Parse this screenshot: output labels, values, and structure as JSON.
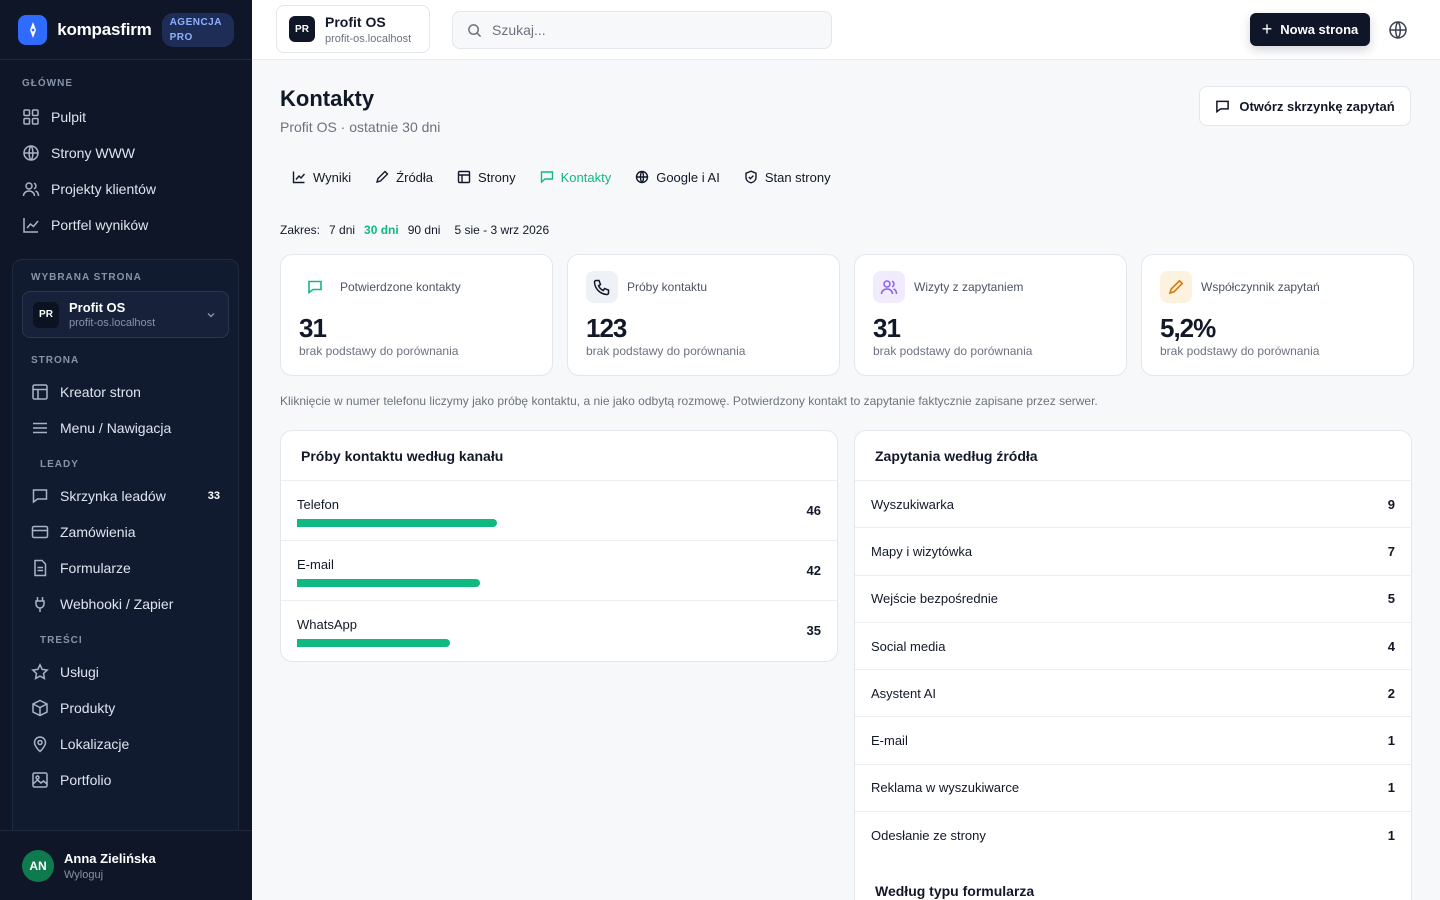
{
  "brand": {
    "name": "kompasfirm",
    "badge": "AGENCJA PRO"
  },
  "sidebar": {
    "main_label": "GŁÓWNE",
    "main_items": [
      {
        "label": "Pulpit",
        "icon": "grid-icon"
      },
      {
        "label": "Strony WWW",
        "icon": "globe-icon"
      },
      {
        "label": "Projekty klientów",
        "icon": "users-icon"
      },
      {
        "label": "Portfel wyników",
        "icon": "chart-icon"
      }
    ],
    "selected_site_label": "WYBRANA STRONA",
    "selected_site": {
      "initials": "PR",
      "name": "Profit OS",
      "domain": "profit-os.localhost"
    },
    "page_label": "STRONA",
    "page_items": [
      {
        "label": "Kreator stron",
        "icon": "layout-icon"
      },
      {
        "label": "Menu / Nawigacja",
        "icon": "menu-icon"
      }
    ],
    "leads_label": "LEADY",
    "leads_items": [
      {
        "label": "Skrzynka leadów",
        "icon": "inbox-icon",
        "count": "33"
      },
      {
        "label": "Zamówienia",
        "icon": "card-icon"
      },
      {
        "label": "Formularze",
        "icon": "file-icon"
      },
      {
        "label": "Webhooki / Zapier",
        "icon": "plug-icon"
      }
    ],
    "content_label": "TREŚCI",
    "content_items": [
      {
        "label": "Usługi",
        "icon": "star-icon"
      },
      {
        "label": "Produkty",
        "icon": "box-icon"
      },
      {
        "label": "Lokalizacje",
        "icon": "pin-icon"
      },
      {
        "label": "Portfolio",
        "icon": "image-icon"
      }
    ],
    "user": {
      "initials": "AN",
      "name": "Anna Zielińska",
      "logout": "Wyloguj"
    }
  },
  "topbar": {
    "site": {
      "initials": "PR",
      "name": "Profit OS",
      "domain": "profit-os.localhost"
    },
    "search_placeholder": "Szukaj...",
    "new_button": "Nowa strona"
  },
  "page": {
    "title": "Kontakty",
    "subtitle": "Profit OS · ostatnie 30 dni",
    "inbox_button": "Otwórz skrzynkę zapytań",
    "tabs": [
      {
        "label": "Wyniki",
        "icon": "chart-icon"
      },
      {
        "label": "Źródła",
        "icon": "pen-icon"
      },
      {
        "label": "Strony",
        "icon": "layout-icon"
      },
      {
        "label": "Kontakty",
        "icon": "message-icon",
        "active": true
      },
      {
        "label": "Google i AI",
        "icon": "globe-icon"
      },
      {
        "label": "Stan strony",
        "icon": "shield-icon"
      }
    ],
    "range": {
      "label": "Zakres:",
      "options": [
        "7 dni",
        "30 dni",
        "90 dni"
      ],
      "active": "30 dni",
      "dates": "5 sie - 3 wrz 2026"
    },
    "kpis": [
      {
        "label": "Potwierdzone kontakty",
        "value": "31",
        "compare": "brak podstawy do porównania",
        "icon": "message-icon",
        "color": "#10b981",
        "bg": "#ffffff"
      },
      {
        "label": "Próby kontaktu",
        "value": "123",
        "compare": "brak podstawy do porównania",
        "icon": "phone-icon",
        "color": "#111827",
        "bg": "#eef1f6"
      },
      {
        "label": "Wizyty z zapytaniem",
        "value": "31",
        "compare": "brak podstawy do porównania",
        "icon": "users-icon",
        "color": "#8b5cf6",
        "bg": "#f1ecfd"
      },
      {
        "label": "Współczynnik zapytań",
        "value": "5,2%",
        "compare": "brak podstawy do porównania",
        "icon": "pen-icon",
        "color": "#f59e0b",
        "bg": "#fdf1e0"
      }
    ],
    "note": "Kliknięcie w numer telefonu liczymy jako próbę kontaktu, a nie jako odbytą rozmowę. Potwierdzony kontakt to zapytanie faktycznie zapisane przez serwer.",
    "channels": {
      "title": "Próby kontaktu według kanału",
      "rows": [
        {
          "name": "Telefon",
          "value": "46",
          "share": 0.4
        },
        {
          "name": "E-mail",
          "value": "42",
          "share": 0.365
        },
        {
          "name": "WhatsApp",
          "value": "35",
          "share": 0.305
        }
      ]
    },
    "sources": {
      "title": "Zapytania według źródła",
      "rows": [
        {
          "name": "Wyszukiwarka",
          "value": "9"
        },
        {
          "name": "Mapy i wizytówka",
          "value": "7"
        },
        {
          "name": "Wejście bezpośrednie",
          "value": "5"
        },
        {
          "name": "Social media",
          "value": "4"
        },
        {
          "name": "Asystent AI",
          "value": "2"
        },
        {
          "name": "E-mail",
          "value": "1"
        },
        {
          "name": "Reklama w wyszukiwarce",
          "value": "1"
        },
        {
          "name": "Odesłanie ze strony",
          "value": "1"
        }
      ],
      "form_type_title": "Według typu formularza"
    }
  }
}
